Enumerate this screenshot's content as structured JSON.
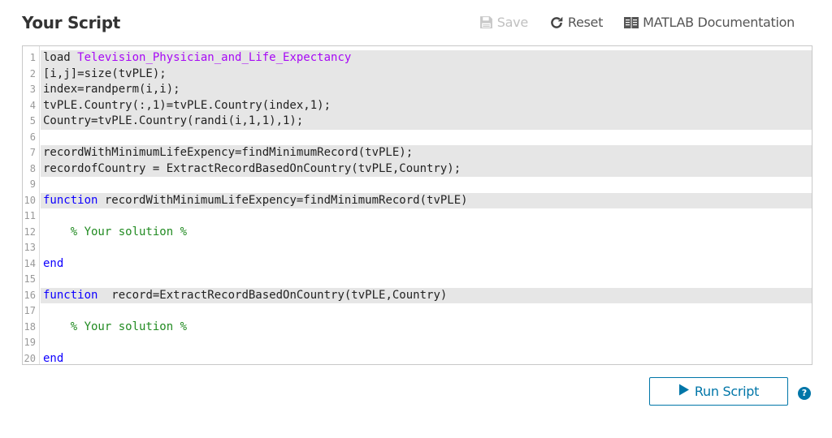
{
  "header": {
    "title": "Your Script"
  },
  "toolbar": {
    "save_label": "Save",
    "save_icon": "floppy-disk-icon",
    "save_enabled": false,
    "reset_label": "Reset",
    "reset_icon": "refresh-icon",
    "docs_label": "MATLAB Documentation",
    "docs_icon": "book-icon"
  },
  "editor": {
    "lines": [
      {
        "n": "1",
        "hl": true,
        "tokens": [
          {
            "t": "load ",
            "c": ""
          },
          {
            "t": "Television_Physician_and_Life_Expectancy",
            "c": "str"
          }
        ]
      },
      {
        "n": "2",
        "hl": true,
        "tokens": [
          {
            "t": "[i,j]=size(tvPLE);",
            "c": ""
          }
        ]
      },
      {
        "n": "3",
        "hl": true,
        "tokens": [
          {
            "t": "index=randperm(i,i);",
            "c": ""
          }
        ]
      },
      {
        "n": "4",
        "hl": true,
        "tokens": [
          {
            "t": "tvPLE.Country(:,1)=tvPLE.Country(index,1);",
            "c": ""
          }
        ]
      },
      {
        "n": "5",
        "hl": true,
        "tokens": [
          {
            "t": "Country=tvPLE.Country(randi(i,1,1),1);",
            "c": ""
          }
        ]
      },
      {
        "n": "6",
        "hl": false,
        "tokens": []
      },
      {
        "n": "7",
        "hl": true,
        "tokens": [
          {
            "t": "recordWithMinimumLifeExpency=findMinimumRecord(tvPLE);",
            "c": ""
          }
        ]
      },
      {
        "n": "8",
        "hl": true,
        "tokens": [
          {
            "t": "recordofCountry = ExtractRecordBasedOnCountry(tvPLE,Country);",
            "c": ""
          }
        ]
      },
      {
        "n": "9",
        "hl": false,
        "tokens": []
      },
      {
        "n": "10",
        "hl": true,
        "tokens": [
          {
            "t": "function",
            "c": "kw"
          },
          {
            "t": " recordWithMinimumLifeExpency=findMinimumRecord(tvPLE)",
            "c": ""
          }
        ]
      },
      {
        "n": "11",
        "hl": false,
        "tokens": []
      },
      {
        "n": "12",
        "hl": false,
        "tokens": [
          {
            "t": "    % Your solution %",
            "c": "cmt"
          }
        ]
      },
      {
        "n": "13",
        "hl": false,
        "tokens": []
      },
      {
        "n": "14",
        "hl": false,
        "tokens": [
          {
            "t": "end",
            "c": "kw"
          }
        ]
      },
      {
        "n": "15",
        "hl": false,
        "tokens": []
      },
      {
        "n": "16",
        "hl": true,
        "tokens": [
          {
            "t": "function",
            "c": "kw"
          },
          {
            "t": "  record=ExtractRecordBasedOnCountry(tvPLE,Country)",
            "c": ""
          }
        ]
      },
      {
        "n": "17",
        "hl": false,
        "tokens": []
      },
      {
        "n": "18",
        "hl": false,
        "tokens": [
          {
            "t": "    % Your solution %",
            "c": "cmt"
          }
        ]
      },
      {
        "n": "19",
        "hl": false,
        "tokens": []
      },
      {
        "n": "20",
        "hl": false,
        "tokens": [
          {
            "t": "end",
            "c": "kw"
          }
        ]
      }
    ]
  },
  "actions": {
    "run_label": "Run Script",
    "run_icon": "play-icon",
    "help_label": "?",
    "help_icon": "help-icon"
  },
  "colors": {
    "accent": "#0076a8",
    "keyword": "#0e00ff",
    "string": "#a709f5",
    "comment": "#228b22",
    "highlight": "#e6e6e6"
  }
}
